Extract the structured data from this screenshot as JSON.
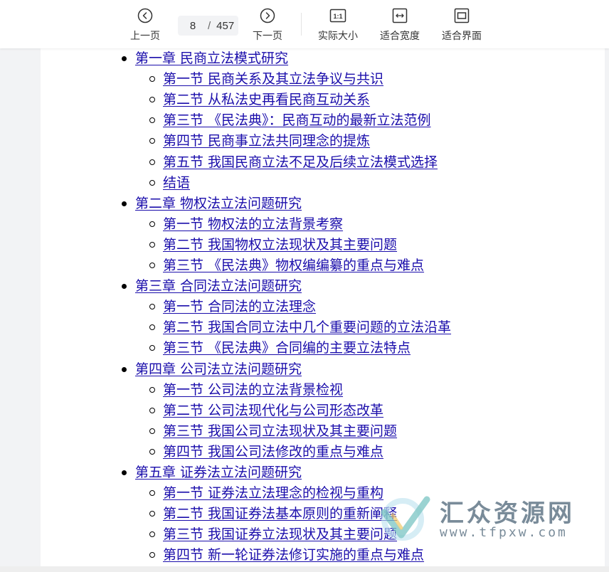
{
  "toolbar": {
    "prev_label": "上一页",
    "next_label": "下一页",
    "current_page": "8",
    "separator": "/",
    "total_pages": "457",
    "actual_size_label": "实际大小",
    "fit_width_label": "适合宽度",
    "fit_page_label": "适合界面",
    "icons": {
      "prev": "chevron-left-circle-icon",
      "next": "chevron-right-circle-icon",
      "actual_size": "one-to-one-icon",
      "fit_width": "fit-width-icon",
      "fit_page": "fit-page-icon"
    }
  },
  "toc": {
    "link_color": "#1a0dab",
    "items": [
      {
        "level": "chapter",
        "text": "第一章 民商立法模式研究"
      },
      {
        "level": "section",
        "text": "第一节 民商关系及其立法争议与共识"
      },
      {
        "level": "section",
        "text": "第二节 从私法史再看民商互动关系"
      },
      {
        "level": "section",
        "text": "第三节 《民法典》：民商互动的最新立法范例"
      },
      {
        "level": "section",
        "text": "第四节 民商事立法共同理念的提炼"
      },
      {
        "level": "section",
        "text": "第五节 我国民商立法不足及后续立法模式选择"
      },
      {
        "level": "section",
        "text": "结语"
      },
      {
        "level": "chapter",
        "text": "第二章 物权法立法问题研究"
      },
      {
        "level": "section",
        "text": "第一节 物权法的立法背景考察"
      },
      {
        "level": "section",
        "text": "第二节 我国物权立法现状及其主要问题"
      },
      {
        "level": "section",
        "text": "第三节 《民法典》物权编编纂的重点与难点"
      },
      {
        "level": "chapter",
        "text": "第三章 合同法立法问题研究"
      },
      {
        "level": "section",
        "text": "第一节 合同法的立法理念"
      },
      {
        "level": "section",
        "text": "第二节 我国合同立法中几个重要问题的立法沿革"
      },
      {
        "level": "section",
        "text": "第三节 《民法典》合同编的主要立法特点"
      },
      {
        "level": "chapter",
        "text": "第四章 公司法立法问题研究"
      },
      {
        "level": "section",
        "text": "第一节 公司法的立法背景检视"
      },
      {
        "level": "section",
        "text": "第二节 公司法现代化与公司形态改革"
      },
      {
        "level": "section",
        "text": "第三节 我国公司立法现状及其主要问题"
      },
      {
        "level": "section",
        "text": "第四节 我国公司法修改的重点与难点"
      },
      {
        "level": "chapter",
        "text": "第五章 证券法立法问题研究"
      },
      {
        "level": "section",
        "text": "第一节 证券法立法理念的检视与重构"
      },
      {
        "level": "section",
        "text": "第二节 我国证券法基本原则的重新阐释"
      },
      {
        "level": "section",
        "text": "第三节 我国证券立法现状及其主要问题"
      },
      {
        "level": "section",
        "text": "第四节 新一轮证券法修订实施的重点与难点"
      }
    ]
  },
  "watermark": {
    "name": "汇众资源网",
    "url": "www.tfpxw.com",
    "logo_icon": "check-swoosh-logo-icon"
  }
}
